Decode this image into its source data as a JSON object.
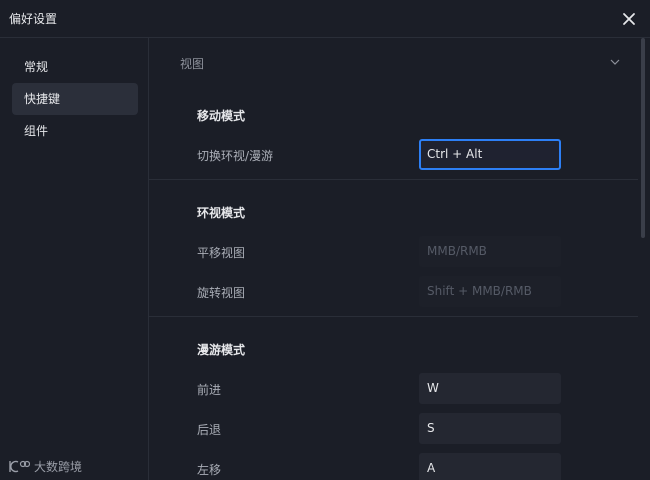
{
  "dialog": {
    "title": "偏好设置",
    "close_icon": "close-icon"
  },
  "sidebar": {
    "items": [
      {
        "label": "常规"
      },
      {
        "label": "快捷键"
      },
      {
        "label": "组件"
      }
    ],
    "active_index": 1,
    "brand": "大数跨境"
  },
  "main": {
    "section": "视图",
    "groups": [
      {
        "title": "移动模式",
        "rows": [
          {
            "label": "切换环视/漫游",
            "value": "Ctrl + Alt"
          }
        ]
      },
      {
        "title": "环视模式",
        "rows": [
          {
            "label": "平移视图",
            "value": "MMB/RMB"
          },
          {
            "label": "旋转视图",
            "value": "Shift + MMB/RMB"
          }
        ]
      },
      {
        "title": "漫游模式",
        "rows": [
          {
            "label": "前进",
            "value": "W"
          },
          {
            "label": "后退",
            "value": "S"
          },
          {
            "label": "左移",
            "value": "A"
          }
        ]
      }
    ]
  },
  "colors": {
    "accent": "#2d7ff5",
    "background": "#1b1e27",
    "field": "#242731"
  }
}
